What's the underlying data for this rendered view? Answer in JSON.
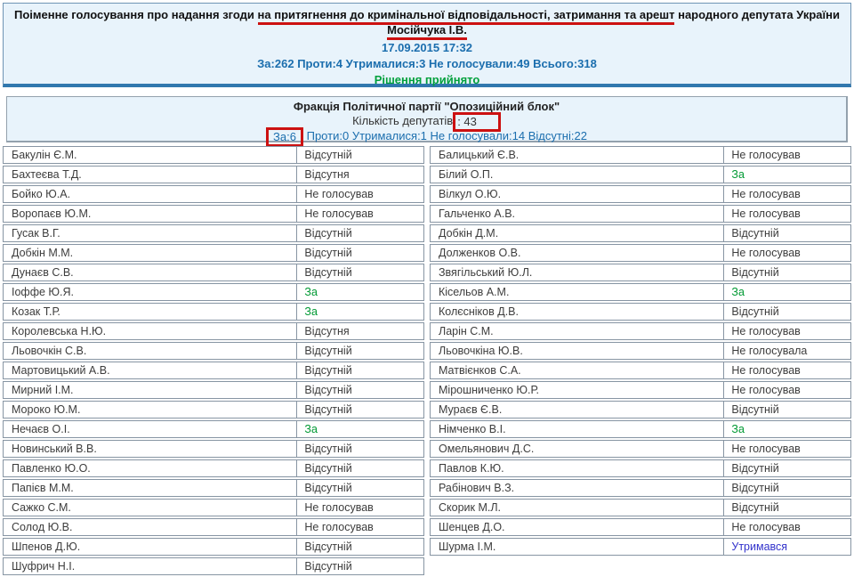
{
  "header": {
    "title": {
      "line1_pre": "Поіменне голосування про надання згоди ",
      "line1_underlined": "на притягнення до кримінальної відповідальності, затримання та арешт",
      "line1_post": " народного депутата України",
      "line2": "Мосійчука І.В."
    },
    "datetime": "17.09.2015 17:32",
    "summary": [
      "За:262",
      "Проти:4",
      "Утрималися:3",
      "Не голосували:49",
      "Всього:318"
    ],
    "result": "Рішення прийнято"
  },
  "fraction": {
    "name": "Фракція Політичної партії \"Опозиційний блок\"",
    "deputies_label": "Кількість депутатів",
    "deputies_value": ": 43",
    "summary": [
      "За:6",
      "Проти:0",
      "Утрималися:1",
      "Не голосували:14",
      "Відсутні:22"
    ]
  },
  "colors": {
    "panel_bg": "#e8f3fb",
    "header_bottom_bar": "#3178ae",
    "accent_blue": "#1b6eae",
    "result_green": "#00a03c",
    "annotation_red": "#cc1111",
    "row_border_gray": "#8795a3"
  },
  "vote_colors": {
    "За": "#009933",
    "Утримався": "#3333cc",
    "default": "#3d3d3d"
  },
  "table": {
    "columns": [
      {
        "rows": [
          {
            "name": "Бакулін Є.М.",
            "vote": "Відсутній"
          },
          {
            "name": "Бахтеєва Т.Д.",
            "vote": "Відсутня"
          },
          {
            "name": "Бойко Ю.А.",
            "vote": "Не голосував"
          },
          {
            "name": "Воропаєв Ю.М.",
            "vote": "Не голосував"
          },
          {
            "name": "Гусак В.Г.",
            "vote": "Відсутній"
          },
          {
            "name": "Добкін М.М.",
            "vote": "Відсутній"
          },
          {
            "name": "Дунаєв С.В.",
            "vote": "Відсутній"
          },
          {
            "name": "Іоффе Ю.Я.",
            "vote": "За"
          },
          {
            "name": "Козак Т.Р.",
            "vote": "За"
          },
          {
            "name": "Королевська Н.Ю.",
            "vote": "Відсутня"
          },
          {
            "name": "Льовочкін С.В.",
            "vote": "Відсутній"
          },
          {
            "name": "Мартовицький А.В.",
            "vote": "Відсутній"
          },
          {
            "name": "Мирний І.М.",
            "vote": "Відсутній"
          },
          {
            "name": "Мороко Ю.М.",
            "vote": "Відсутній"
          },
          {
            "name": "Нечаєв О.І.",
            "vote": "За"
          },
          {
            "name": "Новинський В.В.",
            "vote": "Відсутній"
          },
          {
            "name": "Павленко Ю.О.",
            "vote": "Відсутній"
          },
          {
            "name": "Папієв М.М.",
            "vote": "Відсутній"
          },
          {
            "name": "Сажко С.М.",
            "vote": "Не голосував"
          },
          {
            "name": "Солод Ю.В.",
            "vote": "Не голосував"
          },
          {
            "name": "Шпенов Д.Ю.",
            "vote": "Відсутній"
          },
          {
            "name": "Шуфрич Н.І.",
            "vote": "Відсутній"
          }
        ]
      },
      {
        "rows": [
          {
            "name": "Балицький Є.В.",
            "vote": "Не голосував"
          },
          {
            "name": "Білий О.П.",
            "vote": "За"
          },
          {
            "name": "Вілкул О.Ю.",
            "vote": "Не голосував"
          },
          {
            "name": "Гальченко А.В.",
            "vote": "Не голосував"
          },
          {
            "name": "Добкін Д.М.",
            "vote": "Відсутній"
          },
          {
            "name": "Долженков О.В.",
            "vote": "Не голосував"
          },
          {
            "name": "Звягільський Ю.Л.",
            "vote": "Відсутній"
          },
          {
            "name": "Кісельов А.М.",
            "vote": "За"
          },
          {
            "name": "Колєсніков Д.В.",
            "vote": "Відсутній"
          },
          {
            "name": "Ларін С.М.",
            "vote": "Не голосував"
          },
          {
            "name": "Льовочкіна Ю.В.",
            "vote": "Не голосувала"
          },
          {
            "name": "Матвієнков С.А.",
            "vote": "Не голосував"
          },
          {
            "name": "Мірошниченко Ю.Р.",
            "vote": "Не голосував"
          },
          {
            "name": "Мураєв Є.В.",
            "vote": "Відсутній"
          },
          {
            "name": "Німченко В.І.",
            "vote": "За"
          },
          {
            "name": "Омельянович Д.С.",
            "vote": "Не голосував"
          },
          {
            "name": "Павлов К.Ю.",
            "vote": "Відсутній"
          },
          {
            "name": "Рабінович В.З.",
            "vote": "Відсутній"
          },
          {
            "name": "Скорик М.Л.",
            "vote": "Відсутній"
          },
          {
            "name": "Шенцев Д.О.",
            "vote": "Не голосував"
          },
          {
            "name": "Шурма І.М.",
            "vote": "Утримався"
          }
        ]
      }
    ]
  }
}
